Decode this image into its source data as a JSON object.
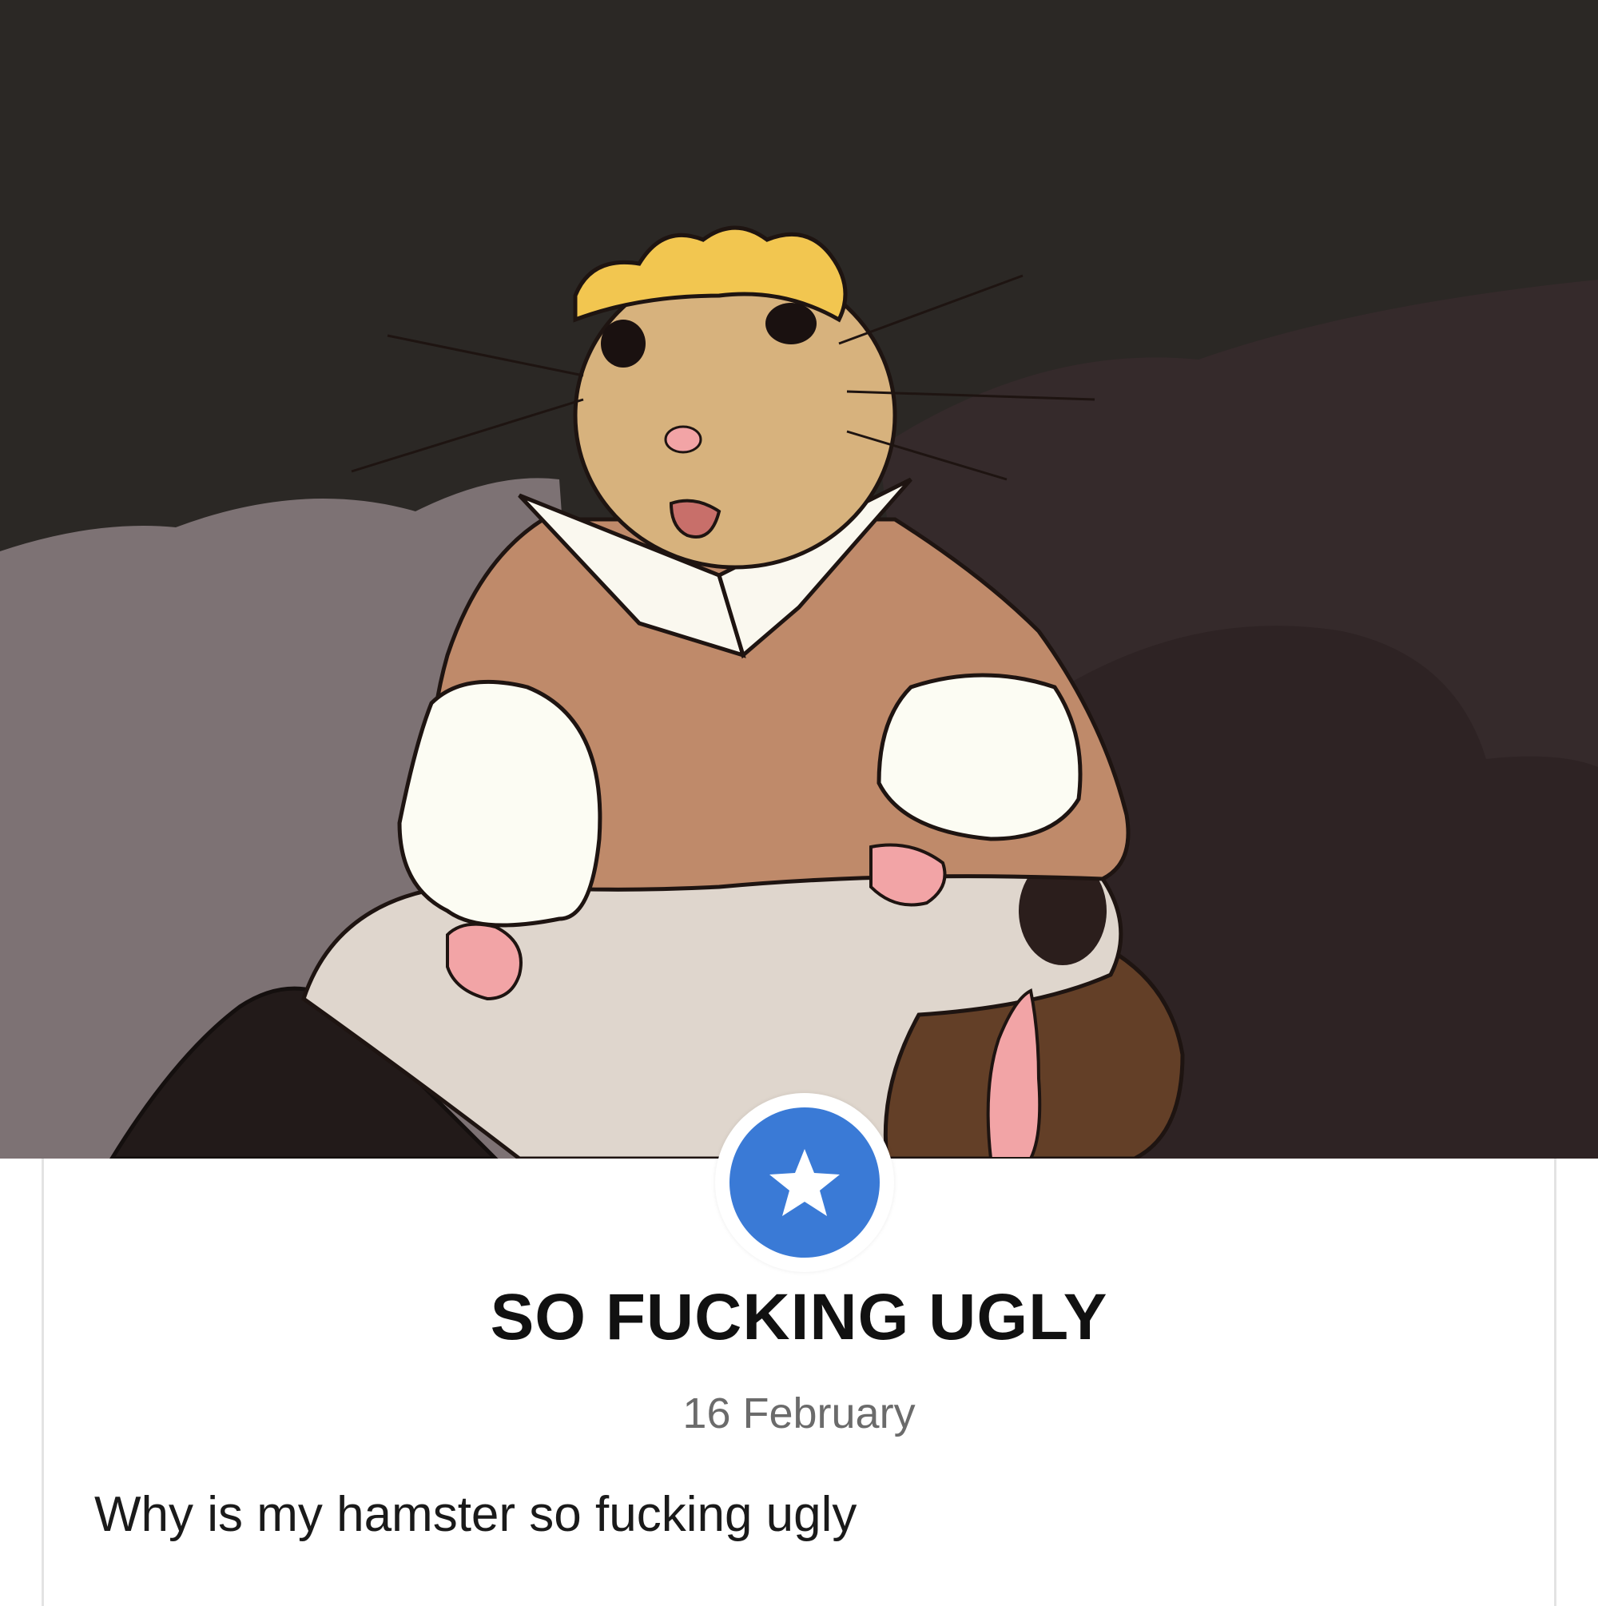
{
  "post": {
    "title": "SO FUCKING UGLY",
    "date": "16 February",
    "body": "Why is my hamster so fucking ugly"
  },
  "badge": {
    "icon": "star-icon",
    "color": "#3a7ad6"
  },
  "illustration": {
    "subject": "hamster-illustration"
  }
}
